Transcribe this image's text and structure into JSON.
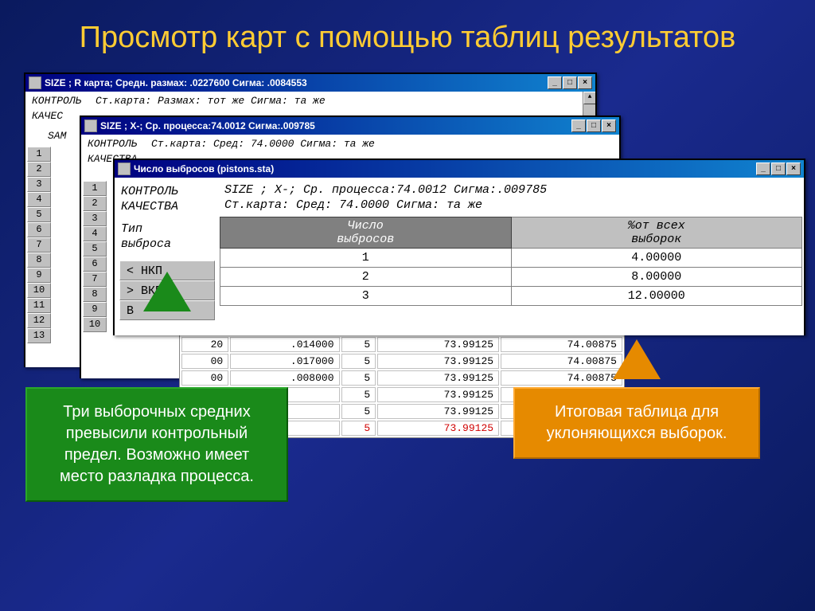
{
  "slide": {
    "title": "Просмотр карт с помощью таблиц результатов"
  },
  "win1": {
    "title": "SIZE ; R карта; Средн. размах: .0227600 Сигма: .0084553",
    "line1_left": "КОНТРОЛЬ",
    "line1_right": "Ст.карта: Размах: тот же Сигма: та же",
    "line2_left": "КАЧЕС",
    "sam": "SAM",
    "rows": [
      "1",
      "2",
      "3",
      "4",
      "5",
      "6",
      "7",
      "8",
      "9",
      "10",
      "11",
      "12",
      "13"
    ]
  },
  "win2": {
    "title": "SIZE ; X-; Ср. процесса:74.0012 Сигма:.009785",
    "line1_left": "КОНТРОЛЬ",
    "line1_right": "Ст.карта: Сред: 74.0000 Сигма: та же",
    "line2_left": "КАЧЕСТВА",
    "rows": [
      "1",
      "2",
      "3",
      "4",
      "5",
      "6",
      "7",
      "8",
      "9",
      "10"
    ]
  },
  "win3": {
    "title": "Число выбросов (pistons.sta)",
    "head1": "SIZE ; X-; Ср. процесса:74.0012 Сигма:.009785",
    "head2": "Ст.карта: Сред: 74.0000 Сигма: та же",
    "lbl1": "КОНТРОЛЬ",
    "lbl2": "КАЧЕСТВА",
    "lbl3": "Тип",
    "lbl4": "выброса",
    "col1": "Число\nвыбросов",
    "col2": "%от всех\nвыборок",
    "row_hdrs": [
      "< НКП",
      "> ВКП",
      "В"
    ],
    "rows": [
      {
        "n": "1",
        "p": "4.00000"
      },
      {
        "n": "2",
        "p": "8.00000"
      },
      {
        "n": "3",
        "p": "12.00000"
      }
    ]
  },
  "under": [
    [
      "20",
      ".014000",
      "5",
      "73.99125",
      "74.00875"
    ],
    [
      "00",
      ".017000",
      "5",
      "73.99125",
      "74.00875"
    ],
    [
      "00",
      ".008000",
      "5",
      "73.99125",
      "74.00875"
    ],
    [
      "",
      "",
      "5",
      "73.99125",
      ""
    ],
    [
      "",
      "",
      "5",
      "73.99125",
      ""
    ],
    [
      "",
      "",
      "5",
      "73.99125",
      ""
    ]
  ],
  "callouts": {
    "green": "Три выборочных средних превысили контрольный предел. Возможно имеет место разладка процесса.",
    "orange": "Итоговая таблица для уклоняющихся выборок."
  },
  "btns": {
    "min": "_",
    "max": "□",
    "close": "×",
    "up": "▲"
  }
}
